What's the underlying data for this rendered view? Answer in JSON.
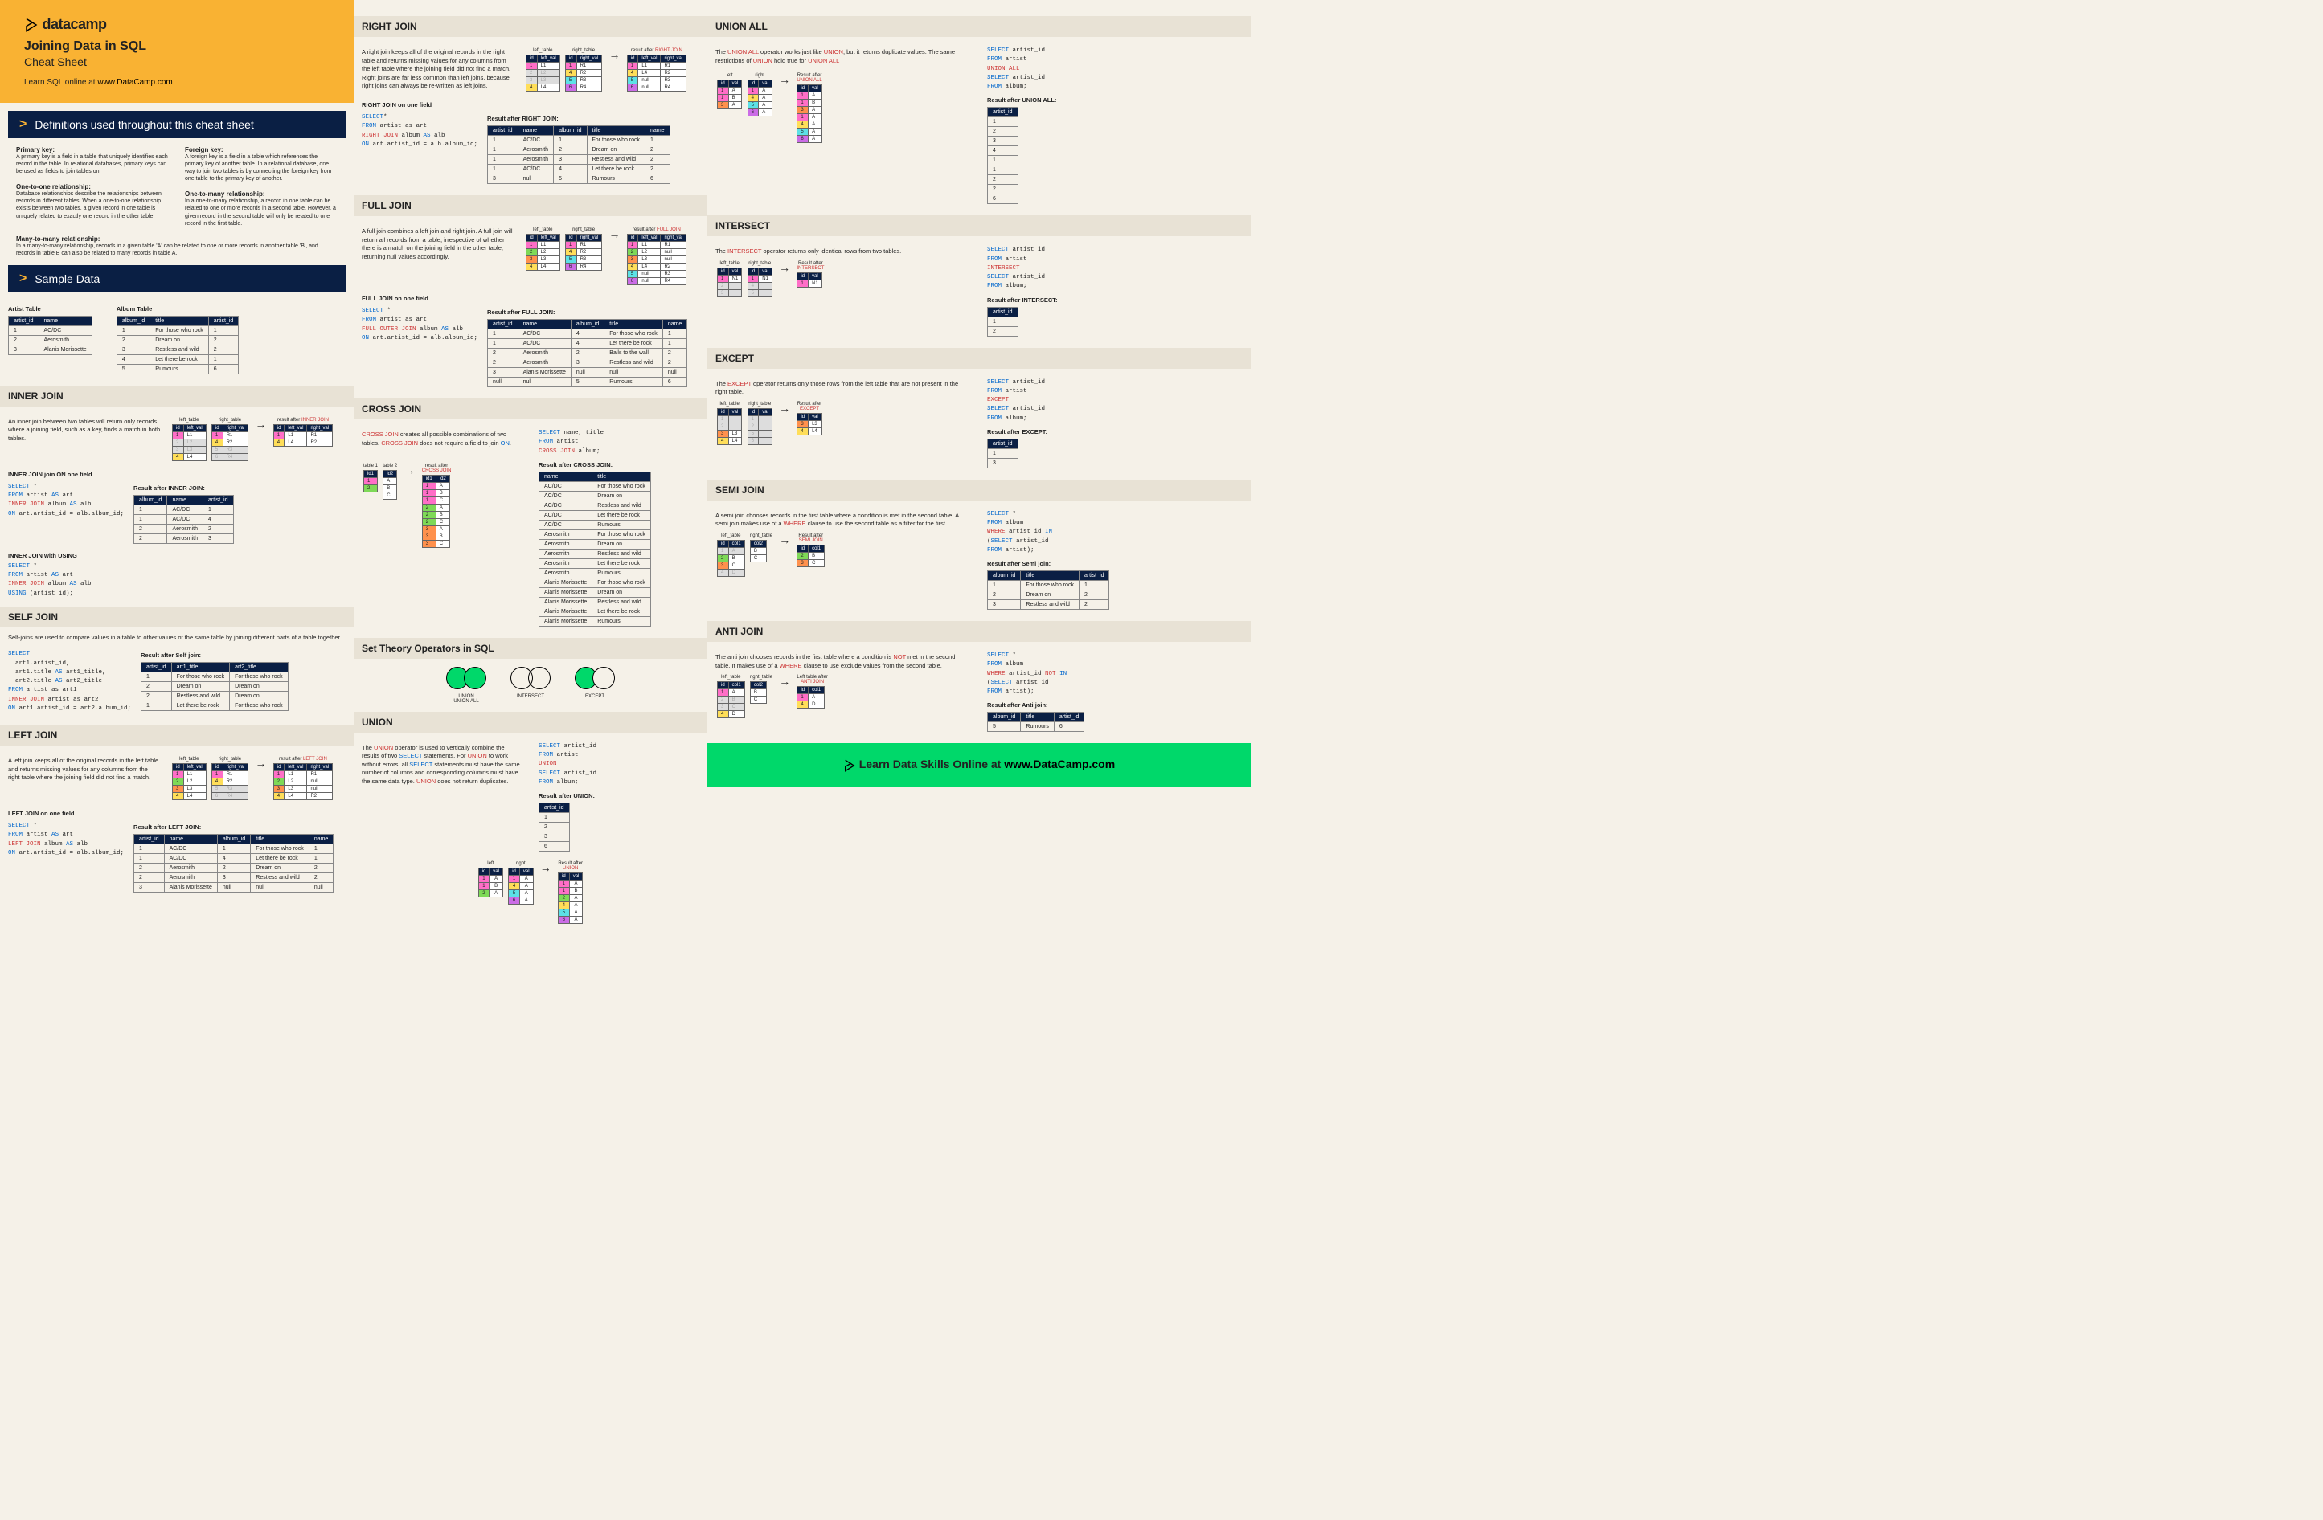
{
  "header": {
    "brand": "datacamp",
    "title": "Joining Data in SQL",
    "subtitle": "Cheat Sheet",
    "learn_prefix": "Learn SQL online at ",
    "learn_url": "www.DataCamp.com"
  },
  "sections": {
    "definitions_header": "Definitions used throughout this cheat sheet",
    "sample_data_header": "Sample Data",
    "inner_join": "INNER JOIN",
    "self_join": "SELF JOIN",
    "left_join": "LEFT JOIN",
    "right_join": "RIGHT JOIN",
    "full_join": "FULL JOIN",
    "cross_join": "CROSS JOIN",
    "set_theory": "Set Theory Operators in SQL",
    "union": "UNION",
    "union_all": "UNION ALL",
    "intersect": "INTERSECT",
    "except": "EXCEPT",
    "semi_join": "SEMI JOIN",
    "anti_join": "ANTI JOIN"
  },
  "definitions": {
    "primary_key": {
      "t": "Primary key:",
      "d": "A primary key is a field in a table that uniquely identifies each record in the table. In relational databases, primary keys can be used as fields to join tables on."
    },
    "foreign_key": {
      "t": "Foreign key:",
      "d": "A foreign key is a field in a table which references the primary key of another table. In a relational database, one way to join two tables is by connecting the foreign key from one table to the primary key of another."
    },
    "one_to_one": {
      "t": "One-to-one relationship:",
      "d": "Database relationships describe the relationships between records in different tables. When a one-to-one relationship exists between two tables, a given record in one table is uniquely related to exactly one record in the other table."
    },
    "one_to_many": {
      "t": "One-to-many relationship:",
      "d": "In a one-to-many relationship, a record in one table can be related to one or more records in a second table. However, a given record in the second table will only be related to one record in the first table."
    },
    "many_to_many": {
      "t": "Many-to-many relationship:",
      "d": "In a many-to-many relationship, records in a given table 'A' can be related to one or more records in another table 'B', and records in table B can also be related to many records in table A."
    }
  },
  "sample": {
    "artist_title": "Artist Table",
    "artist_headers": [
      "artist_id",
      "name"
    ],
    "artist_rows": [
      [
        "1",
        "AC/DC"
      ],
      [
        "2",
        "Aerosmith"
      ],
      [
        "3",
        "Alanis Morissette"
      ]
    ],
    "album_title": "Album Table",
    "album_headers": [
      "album_id",
      "title",
      "artist_id"
    ],
    "album_rows": [
      [
        "1",
        "For those who rock",
        "1"
      ],
      [
        "2",
        "Dream on",
        "2"
      ],
      [
        "3",
        "Restless and wild",
        "2"
      ],
      [
        "4",
        "Let there be rock",
        "1"
      ],
      [
        "5",
        "Rumours",
        "6"
      ]
    ]
  },
  "inner_join": {
    "desc": "An inner join between two tables will return only records where a joining field, such as a key, finds a match in both tables.",
    "label1": "INNER JOIN join ON one field",
    "code1": "SELECT *\nFROM artist AS art\nINNER JOIN album AS alb\nON art.artist_id = alb.album_id;",
    "label2": "INNER JOIN with USING",
    "code2": "SELECT *\nFROM artist AS art\nINNER JOIN album AS alb\nUSING (artist_id);",
    "result_title": "Result after INNER JOIN:",
    "result_headers": [
      "album_id",
      "name",
      "artist_id"
    ],
    "result_rows": [
      [
        "1",
        "AC/DC",
        "1"
      ],
      [
        "1",
        "AC/DC",
        "4"
      ],
      [
        "2",
        "Aerosmith",
        "2"
      ],
      [
        "2",
        "Aerosmith",
        "3"
      ]
    ]
  },
  "self_join": {
    "desc": "Self-joins are used to compare values in a table to other values of the same table by joining different parts of a table together.",
    "code": "SELECT\n  art1.artist_id,\n  art1.title AS art1_title,\n  art2.title AS art2_title\nFROM artist as art1\nINNER JOIN artist as art2\nON art1.artist_id = art2.album_id;",
    "result_title": "Result after Self join:",
    "result_headers": [
      "artist_id",
      "art1_title",
      "art2_title"
    ],
    "result_rows": [
      [
        "1",
        "For those who rock",
        "For those who rock"
      ],
      [
        "2",
        "Dream on",
        "Dream on"
      ],
      [
        "2",
        "Restless and wild",
        "Dream on"
      ],
      [
        "1",
        "Let there be rock",
        "For those who rock"
      ]
    ]
  },
  "left_join": {
    "desc": "A left join keeps all of the original records in the left table and returns missing values for any columns from the right table where the joining field did not find a match.",
    "label": "LEFT JOIN on one field",
    "code": "SELECT *\nFROM artist AS art\nLEFT JOIN album AS alb\nON art.artist_id = alb.album_id;",
    "result_title": "Result after LEFT JOIN:",
    "result_headers": [
      "artist_id",
      "name",
      "album_id",
      "title",
      "name"
    ],
    "result_rows": [
      [
        "1",
        "AC/DC",
        "1",
        "For those who rock",
        "1"
      ],
      [
        "1",
        "AC/DC",
        "4",
        "Let there be rock",
        "1"
      ],
      [
        "2",
        "Aerosmith",
        "2",
        "Dream on",
        "2"
      ],
      [
        "2",
        "Aerosmith",
        "3",
        "Restless and wild",
        "2"
      ],
      [
        "3",
        "Alanis Morissette",
        "null",
        "null",
        "null"
      ]
    ]
  },
  "right_join": {
    "desc": "A right join keeps all of the original records in the right table and returns missing values for any columns from the left table where the joining field did not find a match. Right joins are far less common than left joins, because right joins can always be re-written as left joins.",
    "label": "RIGHT JOIN on one field",
    "code": "SELECT*\nFROM artist as art\nRIGHT JOIN album AS alb\nON art.artist_id = alb.album_id;",
    "result_title": "Result after RIGHT JOIN:",
    "result_headers": [
      "artist_id",
      "name",
      "album_id",
      "title",
      "name"
    ],
    "result_rows": [
      [
        "1",
        "AC/DC",
        "1",
        "For those who rock",
        "1"
      ],
      [
        "1",
        "Aerosmith",
        "2",
        "Dream on",
        "2"
      ],
      [
        "1",
        "Aerosmith",
        "3",
        "Restless and wild",
        "2"
      ],
      [
        "1",
        "AC/DC",
        "4",
        "Let there be rock",
        "2"
      ],
      [
        "3",
        "null",
        "5",
        "Rumours",
        "6"
      ]
    ]
  },
  "full_join": {
    "desc": "A full join combines a left join and right join. A full join will return all records from a table, irrespective of whether there is a match on the joining field in the other table, returning null values accordingly.",
    "label": "FULL JOIN on one field",
    "code": "SELECT *\nFROM artist as art\nFULL OUTER JOIN album AS alb\nON art.artist_id = alb.album_id;",
    "result_title": "Result after FULL JOIN:",
    "result_headers": [
      "artist_id",
      "name",
      "album_id",
      "title",
      "name"
    ],
    "result_rows": [
      [
        "1",
        "AC/DC",
        "4",
        "For those who rock",
        "1"
      ],
      [
        "1",
        "AC/DC",
        "4",
        "Let there be rock",
        "1"
      ],
      [
        "2",
        "Aerosmith",
        "2",
        "Balls to the wall",
        "2"
      ],
      [
        "2",
        "Aerosmith",
        "3",
        "Restless and wild",
        "2"
      ],
      [
        "3",
        "Alanis Morissette",
        "null",
        "null",
        "null"
      ],
      [
        "null",
        "null",
        "5",
        "Rumours",
        "6"
      ]
    ]
  },
  "cross_join": {
    "desc_pre": "CROSS JOIN",
    "desc_mid": " creates all possible combinations of two tables. ",
    "desc_mid2": " does not require a field to join ",
    "code": "SELECT name, title\nFROM artist\nCROSS JOIN album;",
    "result_title": "Result after CROSS JOIN:",
    "result_headers": [
      "name",
      "title"
    ],
    "result_rows": [
      [
        "AC/DC",
        "For those who rock"
      ],
      [
        "AC/DC",
        "Dream on"
      ],
      [
        "AC/DC",
        "Restless and wild"
      ],
      [
        "AC/DC",
        "Let there be rock"
      ],
      [
        "AC/DC",
        "Rumours"
      ],
      [
        "Aerosmith",
        "For those who rock"
      ],
      [
        "Aerosmith",
        "Dream on"
      ],
      [
        "Aerosmith",
        "Restless and wild"
      ],
      [
        "Aerosmith",
        "Let there be rock"
      ],
      [
        "Aerosmith",
        "Rumours"
      ],
      [
        "Alanis Morissette",
        "For those who rock"
      ],
      [
        "Alanis Morissette",
        "Dream on"
      ],
      [
        "Alanis Morissette",
        "Restless and wild"
      ],
      [
        "Alanis Morissette",
        "Let there be rock"
      ],
      [
        "Alanis Morissette",
        "Rumours"
      ]
    ]
  },
  "venn": {
    "union": "UNION\nUNION ALL",
    "intersect": "INTERSECT",
    "except": "EXCEPT"
  },
  "union": {
    "desc": "The UNION operator is used to vertically combine the results of two SELECT statements. For UNION to work without errors, all SELECT statements must have the same number of columns and corresponding columns must have the same data type. UNION does not return duplicates.",
    "code": "SELECT artist_id\nFROM artist\nUNION\nSELECT artist_id\nFROM album;",
    "result_title": "Result after UNION:",
    "result_headers": [
      "artist_id"
    ],
    "result_rows": [
      [
        "1"
      ],
      [
        "2"
      ],
      [
        "3"
      ],
      [
        "6"
      ]
    ]
  },
  "union_all": {
    "desc": "The UNION ALL operator works just like UNION, but it returns duplicate values. The same restrictions of UNION hold true for UNION ALL",
    "code": "SELECT artist_id\nFROM artist\nUNION ALL\nSELECT artist_id\nFROM album;",
    "result_title": "Result after UNION ALL:",
    "result_headers": [
      "artist_id"
    ],
    "result_rows": [
      [
        "1"
      ],
      [
        "2"
      ],
      [
        "3"
      ],
      [
        "4"
      ],
      [
        "1"
      ],
      [
        "1"
      ],
      [
        "2"
      ],
      [
        "2"
      ],
      [
        "6"
      ]
    ]
  },
  "intersect": {
    "desc": "The INTERSECT operator returns only identical rows from two tables.",
    "code": "SELECT artist_id\nFROM artist\nINTERSECT\nSELECT artist_id\nFROM album;",
    "result_title": "Result after INTERSECT:",
    "result_headers": [
      "artist_id"
    ],
    "result_rows": [
      [
        "1"
      ],
      [
        "2"
      ]
    ]
  },
  "except": {
    "desc": "The EXCEPT operator returns only those rows from the left table that are not present in the right table.",
    "code": "SELECT artist_id\nFROM artist\nEXCEPT\nSELECT artist_id\nFROM album;",
    "result_title": "Result after EXCEPT:",
    "result_headers": [
      "artist_id"
    ],
    "result_rows": [
      [
        "1"
      ],
      [
        "3"
      ]
    ]
  },
  "semi_join": {
    "desc": "A semi join chooses records in the first table where a condition is met in the second table. A semi join makes use of a WHERE clause to use the second table as a filter for the first.",
    "code": "SELECT *\nFROM album\nWHERE artist_id IN\n(SELECT artist_id\nFROM artist);",
    "result_title": "Result after Semi join:",
    "result_headers": [
      "album_id",
      "title",
      "artist_id"
    ],
    "result_rows": [
      [
        "1",
        "For those who rock",
        "1"
      ],
      [
        "2",
        "Dream on",
        "2"
      ],
      [
        "3",
        "Restless and wild",
        "2"
      ]
    ]
  },
  "anti_join": {
    "desc": "The anti join chooses records in the first table where a condition is NOT met in the second table. It makes use of a WHERE clause to use exclude values from the second table.",
    "code": "SELECT *\nFROM album\nWHERE artist_id NOT IN\n(SELECT artist_id\nFROM artist);",
    "result_title": "Result after Anti join:",
    "result_headers": [
      "album_id",
      "title",
      "artist_id"
    ],
    "result_rows": [
      [
        "5",
        "Rumours",
        "6"
      ]
    ]
  },
  "footer": {
    "text": "Learn Data Skills Online at ",
    "url": "www.DataCamp.com"
  },
  "diagram_labels": {
    "left_table": "left_table",
    "right_table": "right_table",
    "left": "left",
    "right": "right",
    "id": "id",
    "val": "val",
    "left_val": "left_val",
    "right_val": "right_val",
    "col1": "col1",
    "col2": "col2",
    "result_after": "result after",
    "table1": "table 1",
    "table2": "table 2"
  }
}
